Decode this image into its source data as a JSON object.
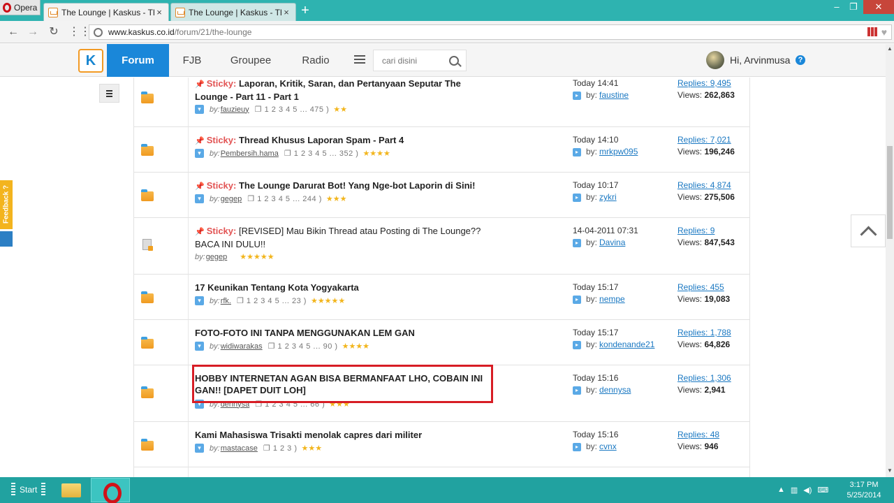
{
  "browser": {
    "menu_label": "Opera",
    "tabs": [
      {
        "title": "The Lounge | Kaskus - The",
        "close": "×"
      },
      {
        "title": "The Lounge | Kaskus - The",
        "close": "×"
      }
    ],
    "new_tab": "+",
    "url_host": "www.kaskus.co.id",
    "url_path": "/forum/21/the-lounge"
  },
  "site": {
    "logo": "K",
    "nav": [
      "Forum",
      "FJB",
      "Groupee",
      "Radio"
    ],
    "search_placeholder": "cari disini",
    "greeting": "Hi, Arvinmusa",
    "help": "?"
  },
  "threads": [
    {
      "sticky_label": "Sticky:",
      "title": "Laporan, Kritik, Saran, dan Pertanyaan Seputar The Lounge - Part 11 - Part 1",
      "by": "by:",
      "author": "fauzieuy",
      "pages": "1 2 3 4 5 ... 475 )",
      "stars": "★★",
      "lastpost_time": "Today 14:41",
      "lastpost_by": "by:",
      "lastpost_user": "faustine",
      "replies": "Replies: 9,495",
      "views_label": "Views:",
      "views": "262,863"
    },
    {
      "sticky_label": "Sticky:",
      "title": "Thread Khusus Laporan Spam - Part 4",
      "by": "by:",
      "author": "Pembersih.hama",
      "pages": "1 2 3 4 5 ... 352 )",
      "stars": "★★★★",
      "lastpost_time": "Today 14:10",
      "lastpost_by": "by:",
      "lastpost_user": "mrkpw095",
      "replies": "Replies: 7,021",
      "views_label": "Views:",
      "views": "196,246"
    },
    {
      "sticky_label": "Sticky:",
      "title": "The Lounge Darurat Bot! Yang Nge-bot Laporin di Sini!",
      "by": "by:",
      "author": "gegep",
      "pages": "1 2 3 4 5 ... 244 )",
      "stars": "★★★",
      "lastpost_time": "Today 10:17",
      "lastpost_by": "by:",
      "lastpost_user": "zykri",
      "replies": "Replies: 4,874",
      "views_label": "Views:",
      "views": "275,506"
    },
    {
      "sticky_label": "Sticky:",
      "title": "[REVISED] Mau Bikin Thread atau Posting di The Lounge?? BACA INI DULU!!",
      "by": "by:",
      "author": "gegep",
      "pages": "",
      "stars": "★★★★★",
      "lastpost_time": "14-04-2011 07:31",
      "lastpost_by": "by:",
      "lastpost_user": "Davina",
      "replies": "Replies: 9",
      "views_label": "Views:",
      "views": "847,543"
    },
    {
      "sticky_label": "",
      "title": "17 Keunikan Tentang Kota Yogyakarta",
      "by": "by:",
      "author": "rfk.",
      "pages": "1 2 3 4 5 ... 23 )",
      "stars": "★★★★★",
      "lastpost_time": "Today 15:17",
      "lastpost_by": "by:",
      "lastpost_user": "nempe",
      "replies": "Replies: 455",
      "views_label": "Views:",
      "views": "19,083"
    },
    {
      "sticky_label": "",
      "title": "FOTO-FOTO INI TANPA MENGGUNAKAN LEM GAN",
      "by": "by:",
      "author": "widiwarakas",
      "pages": "1 2 3 4 5 ... 90 )",
      "stars": "★★★★",
      "lastpost_time": "Today 15:17",
      "lastpost_by": "by:",
      "lastpost_user": "kondenande21",
      "replies": "Replies: 1,788",
      "views_label": "Views:",
      "views": "64,826"
    },
    {
      "sticky_label": "",
      "title": "HOBBY INTERNETAN AGAN BISA BERMANFAAT LHO, COBAIN INI GAN!! [DAPET DUIT LOH]",
      "by": "by:",
      "author": "dennysa",
      "pages": "1 2 3 4 5 ... 66 )",
      "stars": "★★★",
      "lastpost_time": "Today 15:16",
      "lastpost_by": "by:",
      "lastpost_user": "dennysa",
      "replies": "Replies: 1,306",
      "views_label": "Views:",
      "views": "2,941"
    },
    {
      "sticky_label": "",
      "title": "Kami Mahasiswa Trisakti menolak capres dari militer",
      "by": "by:",
      "author": "mastacase",
      "pages": "1 2 3 )",
      "stars": "★★★",
      "lastpost_time": "Today 15:16",
      "lastpost_by": "by:",
      "lastpost_user": "cvnx",
      "replies": "Replies: 48",
      "views_label": "Views:",
      "views": "946"
    }
  ],
  "widgets": {
    "feedback": "Feedback ?"
  },
  "taskbar": {
    "start": "Start",
    "time": "3:17 PM",
    "date": "5/25/2014"
  }
}
